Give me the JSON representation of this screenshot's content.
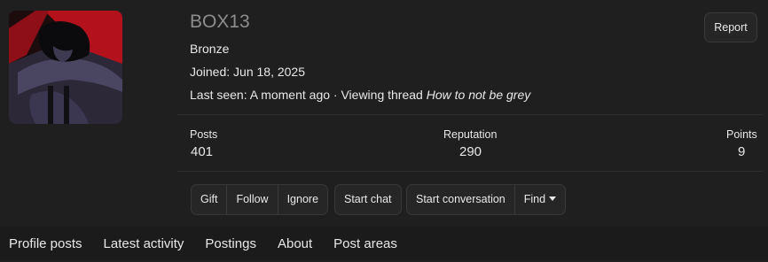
{
  "profile": {
    "username": "BOX13",
    "rank": "Bronze",
    "joined_label": "Joined:",
    "joined_value": "Jun 18, 2025",
    "last_seen_label": "Last seen:",
    "last_seen_value": "A moment ago",
    "separator": "·",
    "viewing_label": "Viewing thread",
    "viewing_thread": "How to not be grey",
    "report_label": "Report"
  },
  "stats": [
    {
      "label": "Posts",
      "value": "401"
    },
    {
      "label": "Reputation",
      "value": "290"
    },
    {
      "label": "Points",
      "value": "9"
    }
  ],
  "actions": {
    "gift": "Gift",
    "follow": "Follow",
    "ignore": "Ignore",
    "start_chat": "Start chat",
    "start_conversation": "Start conversation",
    "find": "Find"
  },
  "tabs": [
    "Profile posts",
    "Latest activity",
    "Postings",
    "About",
    "Post areas"
  ],
  "colors": {
    "background": "#1f1f1f",
    "username": "#8d8d8d",
    "text": "#e8e8e8",
    "avatar_red": "#b3121c"
  }
}
